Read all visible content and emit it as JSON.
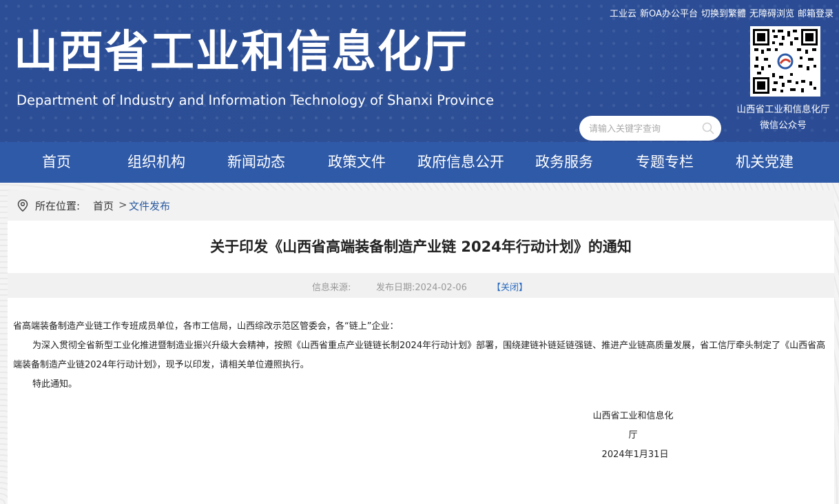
{
  "header": {
    "title": "山西省工业和信息化厅",
    "subtitle": "Department of Industry and Information Technology of Shanxi Province",
    "top_links": [
      "工业云",
      "新OA办公平台",
      "切换到繁體",
      "无障碍浏览",
      "邮箱登录"
    ],
    "qr_caption_line1": "山西省工业和信息化厅",
    "qr_caption_line2": "微信公众号",
    "search_placeholder": "请输入关键字查询"
  },
  "nav": {
    "items": [
      "首页",
      "组织机构",
      "新闻动态",
      "政策文件",
      "政府信息公开",
      "政务服务",
      "专题专栏",
      "机关党建"
    ]
  },
  "breadcrumb": {
    "label": "所在位置:",
    "home": "首页",
    "separator": ">",
    "current": "文件发布"
  },
  "article": {
    "title": "关于印发《山西省高端装备制造产业链 2024年行动计划》的通知",
    "source_label": "信息来源:",
    "date_label": "发布日期:2024-02-06",
    "close_label": "【关闭】",
    "paragraphs": [
      "省高端装备制造产业链工作专班成员单位，各市工信局，山西综改示范区管委会，各“链上”企业：",
      "为深入贯彻全省新型工业化推进暨制造业振兴升级大会精神，按照《山西省重点产业链链长制2024年行动计划》部署，围绕建链补链延链强链、推进产业链高质量发展，省工信厅牵头制定了《山西省高端装备制造产业链2024年行动计划》，现予以印发，请相关单位遵照执行。",
      "特此通知。"
    ],
    "signature_org": "山西省工业和信息化厅",
    "signature_date": "2024年1月31日"
  },
  "colors": {
    "header_bg": "#2d4f96",
    "nav_bg": "#2f5aa8",
    "link_blue": "#2a5aa0"
  }
}
